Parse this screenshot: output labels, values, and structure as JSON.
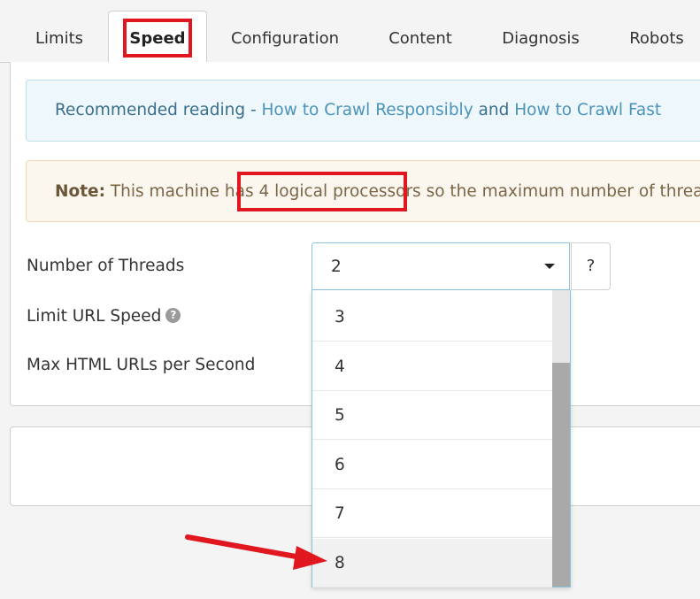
{
  "tabs": [
    {
      "label": "Limits"
    },
    {
      "label": "Speed"
    },
    {
      "label": "Configuration"
    },
    {
      "label": "Content"
    },
    {
      "label": "Diagnosis"
    },
    {
      "label": "Robots"
    }
  ],
  "info_alert": {
    "prefix": "Recommended reading - ",
    "link1": "How to Crawl Responsibly",
    "middle": " and ",
    "link2": "How to Crawl Fast"
  },
  "warn_alert": {
    "note_label": "Note:",
    "text1": " This machine has ",
    "processors": "4 logical processors",
    "text2": " so the maximum number of threads"
  },
  "form": {
    "threads_label": "Number of Threads",
    "limit_speed_label": "Limit URL Speed",
    "max_html_label": "Max HTML URLs per Second",
    "help_button": "?",
    "help_icon": "question-circle"
  },
  "threads_select": {
    "selected": "2",
    "options": [
      "3",
      "4",
      "5",
      "6",
      "7",
      "8"
    ],
    "highlighted": "8"
  },
  "colors": {
    "annotation_red": "#e0171f",
    "info_bg": "#eef7fb",
    "warn_bg": "#fcf7ee",
    "select_border": "#8cc1de"
  }
}
